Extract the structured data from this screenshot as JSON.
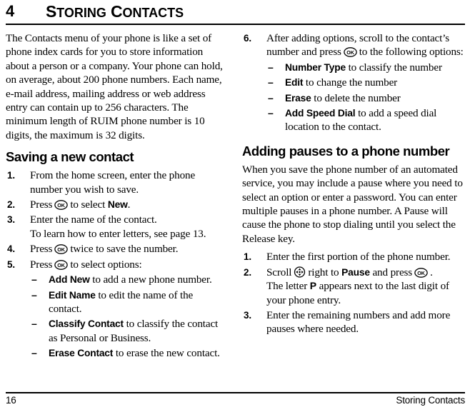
{
  "header": {
    "chapter_number": "4",
    "chapter_title_first": "S",
    "chapter_title_rest": "TORING",
    "chapter_title_first2": "C",
    "chapter_title_rest2": "ONTACTS"
  },
  "footer": {
    "page_number": "16",
    "chapter_name": "Storing Contacts"
  },
  "left_column": {
    "intro_paragraph": "The Contacts menu of your phone is like a set of phone index cards for you to store information about a person or a company. Your phone can hold, on average, about 200 phone numbers. Each name, e-mail address, mailing address or web address entry can contain up to 256 characters. The minimum length of RUIM phone number is 10 digits, the maximum is 32 digits.",
    "section_heading": "Saving a new contact",
    "steps": [
      {
        "marker": "1.",
        "text": "From the home screen, enter the phone number you wish to save."
      },
      {
        "marker": "2.",
        "pre": "Press",
        "icon": "ok-key-icon",
        "mid": "to select",
        "bold": "New",
        "post": "."
      },
      {
        "marker": "3.",
        "text": "Enter the name of the contact.",
        "sub_text": "To learn how to enter letters, see page 13."
      },
      {
        "marker": "4.",
        "pre": "Press",
        "icon": "ok-key-icon",
        "mid": "twice to save the number."
      },
      {
        "marker": "5.",
        "pre": "Press",
        "icon": "ok-key-icon",
        "mid": "to select options:"
      }
    ],
    "options": [
      {
        "marker": "–",
        "bold": "Add New",
        "text": "to add a new phone number."
      },
      {
        "marker": "–",
        "bold": "Edit Name",
        "text": "to edit the name of the contact."
      },
      {
        "marker": "–",
        "bold": "Classify Contact",
        "text": "to classify the contact as Personal or Business."
      },
      {
        "marker": "–",
        "bold": "Erase Contact",
        "text": "to erase the new contact."
      }
    ]
  },
  "right_column": {
    "step6": {
      "marker": "6.",
      "pre": "After adding options, scroll to the contact’s number and press",
      "icon": "ok-key-icon",
      "post": "to the following options:"
    },
    "step6_options": [
      {
        "marker": "–",
        "bold": "Number Type",
        "text": "to classify the number"
      },
      {
        "marker": "–",
        "bold": "Edit",
        "text": "to change the number"
      },
      {
        "marker": "–",
        "bold": "Erase",
        "text": "to delete the number"
      },
      {
        "marker": "–",
        "bold": "Add Speed Dial",
        "text": "to add a speed dial location to the contact."
      }
    ],
    "section_heading": "Adding pauses to a phone number",
    "intro_paragraph": "When you save the phone number of an automated service, you may include a pause where you need to select an option or enter a password. You can enter multiple pauses in a phone number. A Pause will cause the phone to stop dialing until you select the Release key.",
    "steps": [
      {
        "marker": "1.",
        "text": "Enter the first portion of the phone number."
      },
      {
        "marker": "2.",
        "pre": "Scroll",
        "icon": "scroll-key-icon",
        "mid": "right to",
        "bold": "Pause",
        "mid2": "and press",
        "icon2": "ok-key-icon",
        "post": ".",
        "sub_pre": "The letter",
        "sub_bold": "P",
        "sub_post": "appears next to the last digit of your phone entry."
      },
      {
        "marker": "3.",
        "text": "Enter the remaining numbers and add more pauses where needed."
      }
    ]
  },
  "colors": {
    "text": "#000000",
    "background": "#ffffff",
    "rule": "#000000"
  }
}
